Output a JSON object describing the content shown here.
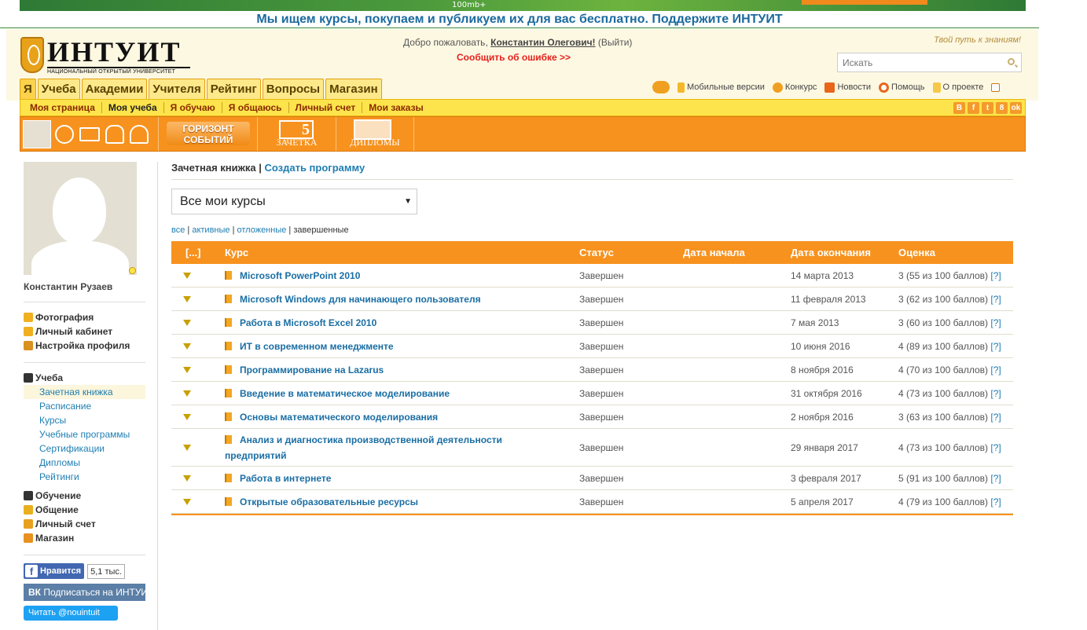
{
  "top_banner": {
    "text": "100mb+"
  },
  "promo": {
    "text": "Мы ищем курсы, покупаем и публикуем их для вас бесплатно. Поддержите ИНТУИТ"
  },
  "logo": {
    "name": "ИНТУИТ",
    "subtitle": "НАЦИОНАЛЬНЫЙ ОТКРЫТЫЙ УНИВЕРСИТЕТ"
  },
  "welcome": {
    "prefix": "Добро пожаловать,",
    "user": "Константин Олеговичǃ",
    "exit_open": "(",
    "exit": "Выйти",
    "exit_close": ")"
  },
  "report_error": "Сообщить об ошибке >>",
  "slogan": "Твой путь к знаниям!",
  "search": {
    "placeholder": "Искать"
  },
  "tabs": [
    "Я",
    "Учеба",
    "Академии",
    "Учителя",
    "Рейтинг",
    "Вопросы",
    "Магазин"
  ],
  "top_links": [
    "Мобильные версии",
    "Конкурс",
    "Новости",
    "Помощь",
    "О проекте"
  ],
  "subnav": [
    "Моя страница",
    "Моя учеба",
    "Я обучаю",
    "Я общаюсь",
    "Личный счет",
    "Мои заказы"
  ],
  "social_squares": [
    "В",
    "f",
    "t",
    "8",
    "ok"
  ],
  "orange_bar": {
    "gorizont": "ГОРИЗОНТ СОБЫТИЙ",
    "zachetka": "ЗАЧЕТКА",
    "zachetka_num": "5",
    "diplomy": "ДИПЛОМЫ"
  },
  "sidebar": {
    "name": "Константин Рузаев",
    "profile_links": [
      "Фотография",
      "Личный кабинет",
      "Настройка профиля"
    ],
    "study_header": "Учеба",
    "study_items": [
      "Зачетная книжка",
      "Расписание",
      "Курсы",
      "Учебные программы",
      "Сертификации",
      "Дипломы",
      "Рейтинги"
    ],
    "other_links": [
      "Обучение",
      "Общение",
      "Личный счет",
      "Магазин"
    ],
    "fb_like": "Нравится",
    "fb_count": "5,1 тыс.",
    "vk": "Подписаться на ИНТУИТ",
    "twitter": "Читать @nouintuit"
  },
  "main": {
    "crumb_current": "Зачетная книжка",
    "crumb_sep": " | ",
    "crumb_create": "Создать программу",
    "select_value": "Все мои курсы",
    "filters": [
      "все",
      "активные",
      "отложенные",
      "завершенные"
    ],
    "table_headers": [
      "[...]",
      "Курс",
      "Статус",
      "Дата начала",
      "Дата окончания",
      "Оценка"
    ],
    "rows": [
      {
        "title": "Microsoft PowerPoint 2010",
        "status": "Завершен",
        "start": "",
        "end": "14 марта 2013",
        "grade": "3 (55 из 100 баллов)",
        "help": "[?]"
      },
      {
        "title": "Microsoft Windows для начинающего пользователя",
        "status": "Завершен",
        "start": "",
        "end": "11 февраля 2013",
        "grade": "3 (62 из 100 баллов)",
        "help": "[?]"
      },
      {
        "title": "Работа в Microsoft Excel 2010",
        "status": "Завершен",
        "start": "",
        "end": "7 мая 2013",
        "grade": "3 (60 из 100 баллов)",
        "help": "[?]"
      },
      {
        "title": "ИТ в современном менеджменте",
        "status": "Завершен",
        "start": "",
        "end": "10 июня 2016",
        "grade": "4 (89 из 100 баллов)",
        "help": "[?]"
      },
      {
        "title": "Программирование на Lazarus",
        "status": "Завершен",
        "start": "",
        "end": "8 ноября 2016",
        "grade": "4 (70 из 100 баллов)",
        "help": "[?]"
      },
      {
        "title": "Введение в математическое моделирование",
        "status": "Завершен",
        "start": "",
        "end": "31 октября 2016",
        "grade": "4 (73 из 100 баллов)",
        "help": "[?]"
      },
      {
        "title": "Основы математического моделирования",
        "status": "Завершен",
        "start": "",
        "end": "2 ноября 2016",
        "grade": "3 (63 из 100 баллов)",
        "help": "[?]"
      },
      {
        "title": "Анализ и диагностика производственной деятельности предприятий",
        "status": "Завершен",
        "start": "",
        "end": "29 января 2017",
        "grade": "4 (73 из 100 баллов)",
        "help": "[?]"
      },
      {
        "title": "Работа в интернете",
        "status": "Завершен",
        "start": "",
        "end": "3 февраля 2017",
        "grade": "5 (91 из 100 баллов)",
        "help": "[?]"
      },
      {
        "title": "Открытые образовательные ресурсы",
        "status": "Завершен",
        "start": "",
        "end": "5 апреля 2017",
        "grade": "4 (79 из 100 баллов)",
        "help": "[?]"
      }
    ]
  }
}
